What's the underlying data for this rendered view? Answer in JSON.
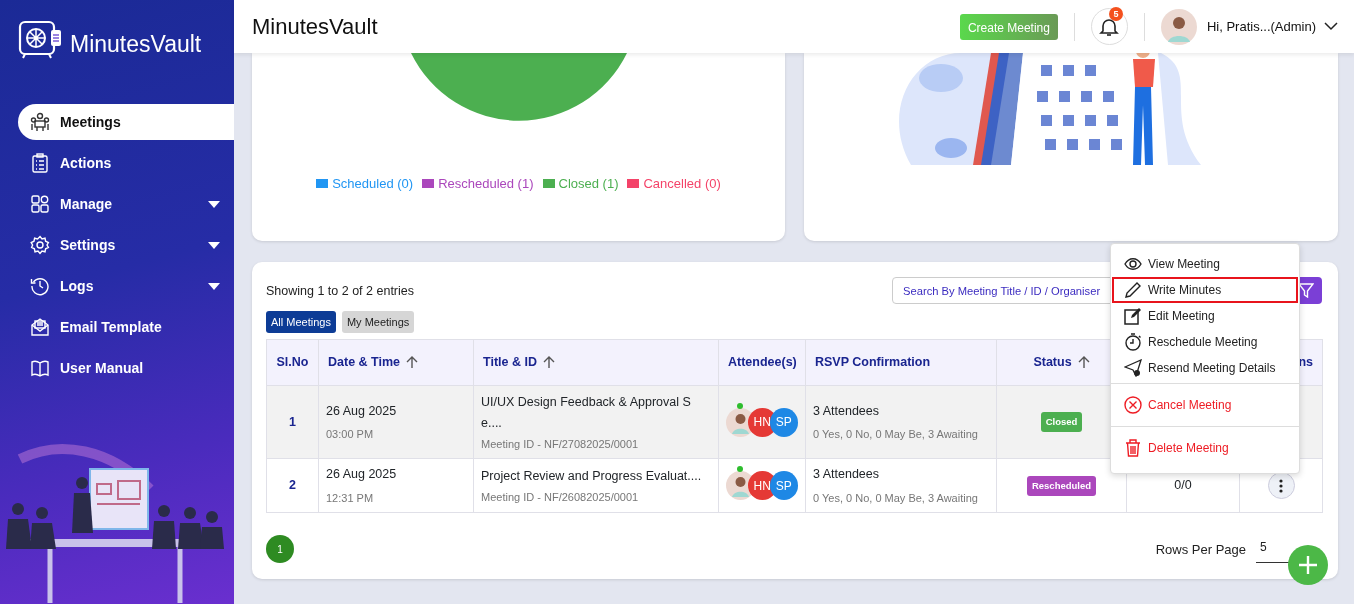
{
  "sidebar": {
    "logo_text": "MinutesVault",
    "items": [
      {
        "label": "Meetings",
        "selected": true,
        "has_submenu": false
      },
      {
        "label": "Actions",
        "selected": false,
        "has_submenu": false
      },
      {
        "label": "Manage",
        "selected": false,
        "has_submenu": true
      },
      {
        "label": "Settings",
        "selected": false,
        "has_submenu": true
      },
      {
        "label": "Logs",
        "selected": false,
        "has_submenu": true
      },
      {
        "label": "Email Template",
        "selected": false,
        "has_submenu": false
      },
      {
        "label": "User Manual",
        "selected": false,
        "has_submenu": false
      }
    ]
  },
  "header": {
    "title": "MinutesVault",
    "create_button": "Create Meeting",
    "notification_count": "5",
    "user_label": "Hi, Pratis...(Admin)"
  },
  "status_chart": {
    "legend": [
      {
        "label": "Scheduled (0)",
        "color": "#2196f3"
      },
      {
        "label": "Rescheduled (1)",
        "color": "#ab47bc"
      },
      {
        "label": "Closed (1)",
        "color": "#4caf50"
      },
      {
        "label": "Cancelled (0)",
        "color": "#f44369"
      }
    ]
  },
  "meetings": {
    "summary": "Showing 1 to 2 of 2 entries",
    "search": {
      "placeholder": "Search By Meeting Title / ID / Organiser"
    },
    "filters": [
      {
        "label": "All Meetings",
        "selected": true
      },
      {
        "label": "My Meetings",
        "selected": false
      }
    ],
    "columns": [
      {
        "label": "Sl.No",
        "sortable": false
      },
      {
        "label": "Date & Time",
        "sortable": true
      },
      {
        "label": "Title & ID",
        "sortable": true
      },
      {
        "label": "Attendee(s)",
        "sortable": false
      },
      {
        "label": "RSVP Confirmation",
        "sortable": false
      },
      {
        "label": "Status",
        "sortable": true
      },
      {},
      {
        "label": "ns",
        "sortable": false
      }
    ],
    "rows": [
      {
        "sl_no": "1",
        "date": "26 Aug 2025",
        "time": "03:00 PM",
        "title": "UI/UX Design Feedback & Approval Se....",
        "meeting_id": "Meeting ID - NF/27082025/0001",
        "attendees": [
          {
            "kind": "photo",
            "online": true
          },
          {
            "kind": "initials",
            "initials": "HN",
            "color": "#e53935"
          },
          {
            "kind": "initials",
            "initials": "SP",
            "color": "#1e88e5"
          }
        ],
        "rsvp": "3 Attendees",
        "rsvp_detail": "0 Yes, 0 No, 0 May Be, 3 Awaiting",
        "status": {
          "label": "Closed",
          "color": "#4caf50"
        }
      },
      {
        "sl_no": "2",
        "date": "26 Aug 2025",
        "time": "12:31 PM",
        "title": "Project Review and Progress Evaluat....",
        "meeting_id": "Meeting ID - NF/26082025/0001",
        "attendees": [
          {
            "kind": "photo",
            "online": true
          },
          {
            "kind": "initials",
            "initials": "HN",
            "color": "#e53935"
          },
          {
            "kind": "initials",
            "initials": "SP",
            "color": "#1e88e5"
          }
        ],
        "rsvp": "3 Attendees",
        "rsvp_detail": "0 Yes, 0 No, 0 May Be, 3 Awaiting",
        "status": {
          "label": "Rescheduled",
          "color": "#ab47bc"
        },
        "column_7": "0/0",
        "menu_button": true
      }
    ],
    "pagination": [
      {
        "label": "1",
        "selected": true
      }
    ],
    "rows_per_page_label": "Rows Per Page",
    "rows_per_page": "5"
  },
  "action_menu": {
    "items": [
      {
        "label": "View Meeting",
        "kind": "normal",
        "highlighted": false
      },
      {
        "label": "Write Minutes",
        "kind": "normal",
        "highlighted": true
      },
      {
        "label": "Edit Meeting",
        "kind": "normal",
        "highlighted": false
      },
      {
        "label": "Reschedule Meeting",
        "kind": "normal",
        "highlighted": false
      },
      {
        "label": "Resend Meeting Details",
        "kind": "normal",
        "highlighted": false
      },
      {
        "label": "Cancel Meeting",
        "kind": "danger",
        "highlighted": false
      },
      {
        "label": "Delete Meeting",
        "kind": "danger",
        "highlighted": false
      }
    ]
  }
}
